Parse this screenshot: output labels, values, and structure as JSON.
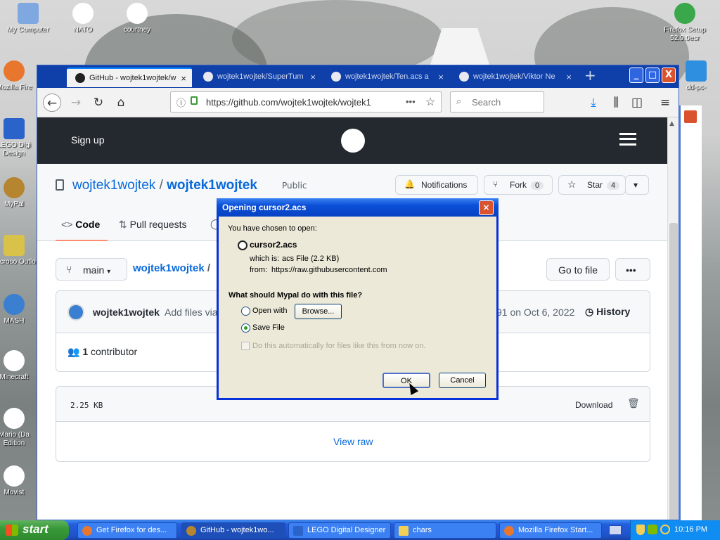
{
  "desktop": {
    "icons": [
      {
        "label": "My Computer"
      },
      {
        "label": "NATO"
      },
      {
        "label": "courtney"
      },
      {
        "label": "Mozilla Fire"
      },
      {
        "label": "LEGO Digi Design"
      },
      {
        "label": "MyPal"
      },
      {
        "label": "Microso Outlo"
      },
      {
        "label": "MASH"
      },
      {
        "label": "Minecraft"
      },
      {
        "label": "Mario (Da Edition"
      },
      {
        "label": "Movist"
      },
      {
        "label": "Firefox Setup 52.9.0esr"
      },
      {
        "label": "dd-pc-"
      }
    ]
  },
  "browser": {
    "tabs": [
      {
        "label": "GitHub - wojtek1wojtek/w",
        "active": true
      },
      {
        "label": "wojtek1wojtek/SuperTum",
        "active": false
      },
      {
        "label": "wojtek1wojtek/Ten.acs a",
        "active": false
      },
      {
        "label": "wojtek1wojtek/Viktor Ne",
        "active": false
      }
    ],
    "new_tab": "+",
    "url": "https://github.com/wojtek1wojtek/wojtek1",
    "url_menu": "•••",
    "search_placeholder": "Search",
    "window_buttons": {
      "minimize": "_",
      "maximize": "□",
      "close": "X"
    }
  },
  "github": {
    "sign_up": "Sign up",
    "owner": "wojtek1wojtek",
    "separator": "/",
    "repo": "wojtek1wojtek",
    "visibility": "Public",
    "notifications": "Notifications",
    "fork": "Fork",
    "fork_count": "0",
    "star": "Star",
    "star_count": "4",
    "nav": {
      "code": "Code",
      "pulls": "Pull requests"
    },
    "branch": "main",
    "breadcrumb_repo": "wojtek1wojtek",
    "breadcrumb_sep": "/",
    "goto_file": "Go to file",
    "more": "•••",
    "commit_author": "wojtek1wojtek",
    "commit_message": "Add files via",
    "commit_date": "91 on Oct 6, 2022",
    "history": "History",
    "contributors_count": "1",
    "contributors_label": "contributor",
    "file_size": "2.25 KB",
    "download": "Download",
    "view_raw": "View raw"
  },
  "dialog": {
    "title": "Opening cursor2.acs",
    "intro": "You have chosen to open:",
    "filename": "cursor2.acs",
    "which_is_label": "which is:",
    "which_is_value": "acs File (2.2 KB)",
    "from_label": "from:",
    "from_value": "https://raw.githubusercontent.com",
    "question": "What should Mypal do with this file?",
    "open_with": "Open with",
    "browse": "Browse...",
    "save_file": "Save File",
    "auto_checkbox": "Do this automatically for files like this from now on.",
    "ok": "OK",
    "cancel": "Cancel",
    "selected_option": "Save File"
  },
  "taskbar": {
    "start": "start",
    "tasks": [
      {
        "label": "Get Firefox for des..."
      },
      {
        "label": "GitHub - wojtek1wo...",
        "active": true
      },
      {
        "label": "LEGO Digital Designer"
      },
      {
        "label": "chars"
      },
      {
        "label": "Mozilla Firefox Start..."
      }
    ],
    "clock": "10:16 PM"
  },
  "colors": {
    "xp_blue": "#0831d9",
    "github_dark": "#24292f",
    "link_blue": "#0969da",
    "start_green": "#3a9a3a"
  }
}
